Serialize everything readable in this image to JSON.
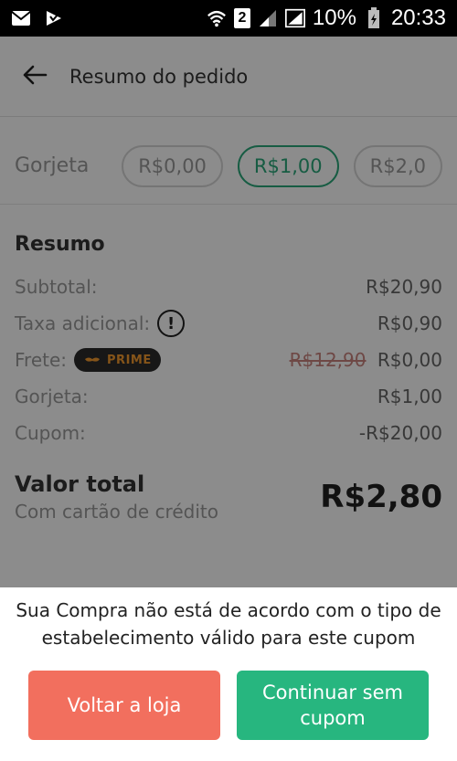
{
  "status_bar": {
    "sim": "2",
    "battery": "10%",
    "time": "20:33"
  },
  "header": {
    "title": "Resumo do pedido"
  },
  "tip": {
    "label": "Gorjeta",
    "options": [
      "R$0,00",
      "R$1,00",
      "R$2,0"
    ],
    "selected": "R$1,00"
  },
  "summary": {
    "title": "Resumo",
    "subtotal_label": "Subtotal:",
    "subtotal_value": "R$20,90",
    "fee_label": "Taxa adicional:",
    "fee_value": "R$0,90",
    "shipping_label": "Frete:",
    "prime_badge": "PRIME",
    "shipping_old": "R$12,90",
    "shipping_value": "R$0,00",
    "tip_label": "Gorjeta:",
    "tip_value": "R$1,00",
    "coupon_label": "Cupom:",
    "coupon_value": "-R$20,00",
    "total_label": "Valor total",
    "total_sub": "Com cartão de crédito",
    "total_value": "R$2,80"
  },
  "dialog": {
    "message": "Sua Compra não está de acordo com o tipo de estabelecimento válido para este cupom",
    "back_button": "Voltar a loja",
    "continue_button": "Continuar sem cupom"
  },
  "colors": {
    "accent_green": "#27b67f",
    "danger_red": "#f26f5e",
    "prime_orange": "#f29a2e"
  }
}
